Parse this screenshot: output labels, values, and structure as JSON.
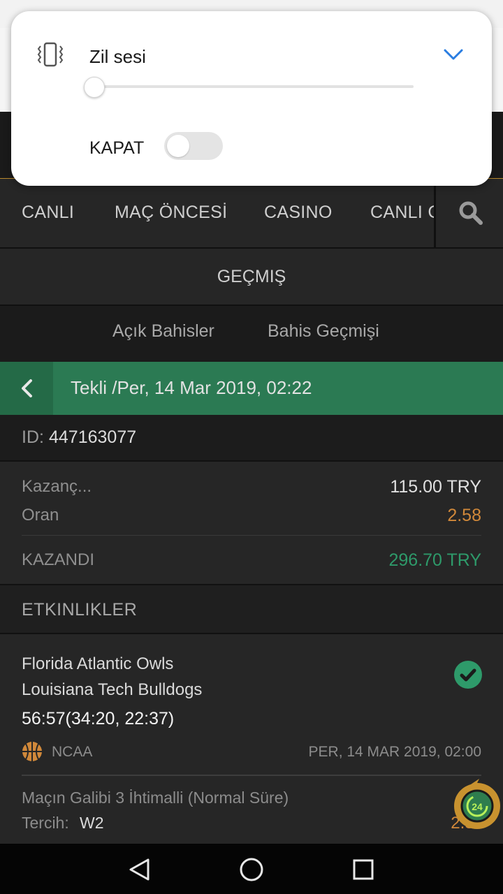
{
  "popup": {
    "title": "Zil sesi",
    "volume_level": 0,
    "toggle_label": "KAPAT",
    "toggle_on": false
  },
  "nav": {
    "items": [
      "CANLI",
      "MAÇ ÖNCESİ",
      "CASINO",
      "CANLI C"
    ]
  },
  "section": {
    "title": "GEÇMIŞ"
  },
  "subtabs": [
    "Açık Bahisler",
    "Bahis Geçmişi"
  ],
  "bet": {
    "header": "Tekli /Per, 14 Mar 2019, 02:22",
    "id_label": "ID:",
    "id_value": "447163077",
    "stake_label": "Kazanç...",
    "stake_value": "115.00 TRY",
    "odds_label": "Oran",
    "odds_value": "2.58",
    "result_label": "KAZANDI",
    "result_value": "296.70 TRY"
  },
  "events": {
    "header": "ETKINLIKLER",
    "items": [
      {
        "team1": "Florida Atlantic Owls",
        "team2": "Louisiana Tech Bulldogs",
        "score": "56:57(34:20, 22:37)",
        "league": "NCAA",
        "datetime": "PER, 14 MAR 2019, 02:00",
        "market": "Maçın Galibi 3 İhtimalli (Normal Süre)",
        "pick_label": "Tercih:",
        "pick_value": "W2",
        "odd": "2.58",
        "status": "won"
      }
    ]
  },
  "colors": {
    "green": "#2b7a53",
    "orange": "#d0883a",
    "win_green": "#2e9a6a",
    "gold": "#b9892e"
  },
  "support_badge": "24"
}
